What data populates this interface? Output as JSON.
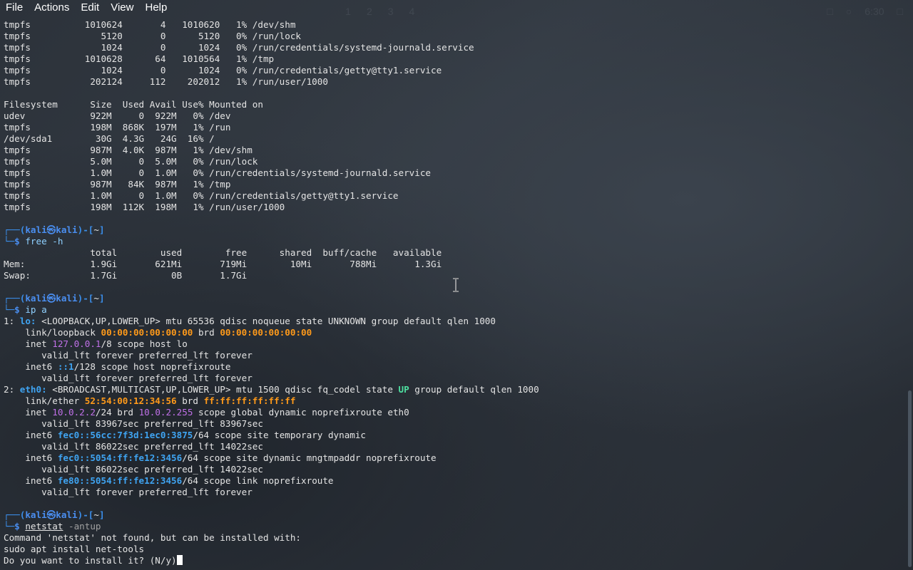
{
  "menubar": {
    "file": "File",
    "actions": "Actions",
    "edit": "Edit",
    "view": "View",
    "help": "Help"
  },
  "panel_ghost": {
    "workspaces": [
      "1",
      "2",
      "3",
      "4"
    ],
    "clock": "6:30"
  },
  "df_raw": [
    [
      "tmpfs",
      "1010624",
      "4",
      "1010620",
      "1%",
      "/dev/shm"
    ],
    [
      "tmpfs",
      "5120",
      "0",
      "5120",
      "0%",
      "/run/lock"
    ],
    [
      "tmpfs",
      "1024",
      "0",
      "1024",
      "0%",
      "/run/credentials/systemd-journald.service"
    ],
    [
      "tmpfs",
      "1010628",
      "64",
      "1010564",
      "1%",
      "/tmp"
    ],
    [
      "tmpfs",
      "1024",
      "0",
      "1024",
      "0%",
      "/run/credentials/getty@tty1.service"
    ],
    [
      "tmpfs",
      "202124",
      "112",
      "202012",
      "1%",
      "/run/user/1000"
    ]
  ],
  "df_h": {
    "header": [
      "Filesystem",
      "Size",
      "Used",
      "Avail",
      "Use%",
      "Mounted on"
    ],
    "rows": [
      [
        "udev",
        "922M",
        "0",
        "922M",
        "0%",
        "/dev"
      ],
      [
        "tmpfs",
        "198M",
        "868K",
        "197M",
        "1%",
        "/run"
      ],
      [
        "/dev/sda1",
        "30G",
        "4.3G",
        "24G",
        "16%",
        "/"
      ],
      [
        "tmpfs",
        "987M",
        "4.0K",
        "987M",
        "1%",
        "/dev/shm"
      ],
      [
        "tmpfs",
        "5.0M",
        "0",
        "5.0M",
        "0%",
        "/run/lock"
      ],
      [
        "tmpfs",
        "1.0M",
        "0",
        "1.0M",
        "0%",
        "/run/credentials/systemd-journald.service"
      ],
      [
        "tmpfs",
        "987M",
        "84K",
        "987M",
        "1%",
        "/tmp"
      ],
      [
        "tmpfs",
        "1.0M",
        "0",
        "1.0M",
        "0%",
        "/run/credentials/getty@tty1.service"
      ],
      [
        "tmpfs",
        "198M",
        "112K",
        "198M",
        "1%",
        "/run/user/1000"
      ]
    ]
  },
  "prompt": {
    "user": "kali",
    "at": "㉿",
    "host": "kali",
    "dir": "~"
  },
  "cmd1": {
    "name": "free",
    "args": " -h"
  },
  "free": {
    "header": [
      "total",
      "used",
      "free",
      "shared",
      "buff/cache",
      "available"
    ],
    "mem": [
      "Mem:",
      "1.9Gi",
      "621Mi",
      "719Mi",
      "10Mi",
      "788Mi",
      "1.3Gi"
    ],
    "swap": [
      "Swap:",
      "1.7Gi",
      "0B",
      "1.7Gi"
    ]
  },
  "cmd2": {
    "name": "ip",
    "args": " a"
  },
  "ip": {
    "lo_idx": "1: ",
    "lo_name": "lo:",
    "lo_flags": " <LOOPBACK,UP,LOWER_UP> mtu 65536 qdisc noqueue state UNKNOWN group default qlen 1000",
    "lo_link": "    link/loopback ",
    "lo_mac": "00:00:00:00:00:00",
    "lo_brd_label": " brd ",
    "lo_brd": "00:00:00:00:00:00",
    "lo_inet_label": "    inet ",
    "lo_inet": "127.0.0.1",
    "lo_inet_rest": "/8 scope host lo",
    "lo_valid1": "       valid_lft forever preferred_lft forever",
    "lo_inet6_label": "    inet6 ",
    "lo_inet6": "::1",
    "lo_inet6_rest": "/128 scope host noprefixroute",
    "lo_valid2": "       valid_lft forever preferred_lft forever",
    "eth_idx": "2: ",
    "eth_name": "eth0:",
    "eth_flags": " <BROADCAST,MULTICAST,UP,LOWER_UP> mtu 1500 qdisc fq_codel state ",
    "eth_state": "UP",
    "eth_flags_rest": " group default qlen 1000",
    "eth_link": "    link/ether ",
    "eth_mac": "52:54:00:12:34:56",
    "eth_brd_label": " brd ",
    "eth_brd": "ff:ff:ff:ff:ff:ff",
    "eth_inet_label": "    inet ",
    "eth_inet": "10.0.2.2",
    "eth_inet_mid": "/24 brd ",
    "eth_inet_brd": "10.0.2.255",
    "eth_inet_rest": " scope global dynamic noprefixroute eth0",
    "eth_valid1": "       valid_lft 83967sec preferred_lft 83967sec",
    "eth_inet6a_label": "    inet6 ",
    "eth_inet6a": "fec0::56cc:7f3d:1ec0:3875",
    "eth_inet6a_rest": "/64 scope site temporary dynamic",
    "eth_valid2": "       valid_lft 86022sec preferred_lft 14022sec",
    "eth_inet6b_label": "    inet6 ",
    "eth_inet6b": "fec0::5054:ff:fe12:3456",
    "eth_inet6b_rest": "/64 scope site dynamic mngtmpaddr noprefixroute",
    "eth_valid3": "       valid_lft 86022sec preferred_lft 14022sec",
    "eth_inet6c_label": "    inet6 ",
    "eth_inet6c": "fe80::5054:ff:fe12:3456",
    "eth_inet6c_rest": "/64 scope link noprefixroute",
    "eth_valid4": "       valid_lft forever preferred_lft forever"
  },
  "cmd3": {
    "name": "netstat",
    "args": " -antup"
  },
  "netstat_out": [
    "Command 'netstat' not found, but can be installed with:",
    "sudo apt install net-tools"
  ],
  "install_question": "Do you want to install it? (N/y)"
}
